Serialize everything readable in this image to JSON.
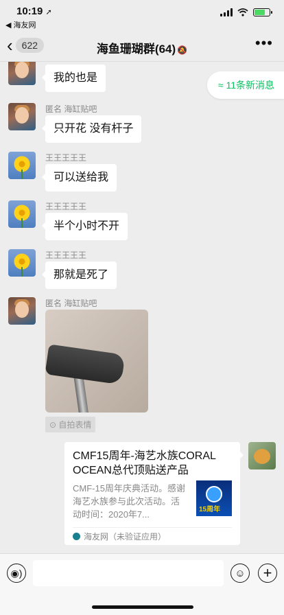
{
  "status": {
    "time": "10:19",
    "location_arrow": "➚",
    "back_app": "◀ 海友网",
    "battery_color": "#4cd964"
  },
  "nav": {
    "back_count": "622",
    "title": "海鱼珊瑚群(64)",
    "mute_icon": "bell-slash-icon",
    "more": "•••"
  },
  "new_messages": "≈ 11条新消息",
  "messages": [
    {
      "sender": "",
      "text": "我的也是",
      "avatar": "kid"
    },
    {
      "sender": "匿名 海缸贴吧",
      "text": "只开花 没有杆子",
      "avatar": "kid"
    },
    {
      "sender": "王王王王王",
      "text": "可以送给我",
      "avatar": "flower"
    },
    {
      "sender": "王王王王王",
      "text": "半个小时不开",
      "avatar": "flower"
    },
    {
      "sender": "王王王王王",
      "text": "那就是死了",
      "avatar": "flower"
    },
    {
      "sender": "匿名 海缸贴吧",
      "sticker_tag": "⊙ 自拍表情",
      "avatar": "kid"
    }
  ],
  "link_card": {
    "title": "CMF15周年-海艺水族CORAL OCEAN总代顶贴送产品",
    "description": "CMF-15周年庆典活动。感谢海艺水族参与此次活动。活动时间：2020年7...",
    "thumb_text": "15周年",
    "source": "海友网（未验证应用）"
  },
  "input_bar": {
    "voice_glyph": "◉)",
    "emoji_glyph": "☺",
    "plus_glyph": "+"
  },
  "accent_color": "#07c160"
}
